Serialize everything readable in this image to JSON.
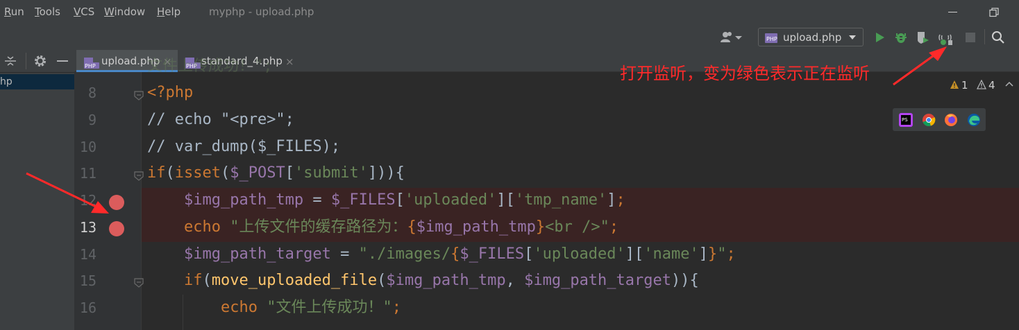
{
  "menu": {
    "items": [
      "Run",
      "Tools",
      "VCS",
      "Window",
      "Help"
    ],
    "window_title": "myphp - upload.php"
  },
  "toolbar": {
    "run_config": "upload.php",
    "icons": [
      "user-icon",
      "run-icon",
      "debug-icon",
      "coverage-icon",
      "listen-debug-icon",
      "stop-icon",
      "search-icon"
    ]
  },
  "project": {
    "selected_item": "hp"
  },
  "tabs": [
    {
      "label": "upload.php",
      "close": "×",
      "active": true
    },
    {
      "label": "standard_4.php",
      "close": "×",
      "active": false
    }
  ],
  "inspections": {
    "errors": "1",
    "warnings": "4"
  },
  "browsers": [
    "phpstorm-icon",
    "chrome-icon",
    "firefox-icon",
    "edge-icon"
  ],
  "annotation": "打开监听，变为绿色表示正在监听",
  "breakpoints": [
    12,
    13
  ],
  "colors": {
    "keyword": "#cc7832",
    "string": "#6a8759",
    "variable": "#9876aa",
    "function": "#ffc66d",
    "comment": "#a9b7c6",
    "breakpoint": "#db5c5c",
    "annotation": "#ff2a2a"
  },
  "code": {
    "partial_top": "文件上传成功！\";",
    "lines": [
      {
        "number": "8",
        "tokens": [
          {
            "t": "<?php",
            "c": "keyword"
          }
        ]
      },
      {
        "number": "9",
        "tokens": [
          {
            "t": "// echo \"<pre>\";",
            "c": "plain"
          }
        ]
      },
      {
        "number": "10",
        "tokens": [
          {
            "t": "// var_dump($_FILES);",
            "c": "plain"
          }
        ]
      },
      {
        "number": "11",
        "tokens": [
          {
            "t": "if",
            "c": "keyword"
          },
          {
            "t": "(",
            "c": "plain"
          },
          {
            "t": "isset",
            "c": "keyword"
          },
          {
            "t": "(",
            "c": "plain"
          },
          {
            "t": "$_POST",
            "c": "variable"
          },
          {
            "t": "[",
            "c": "plain"
          },
          {
            "t": "'submit'",
            "c": "string"
          },
          {
            "t": "])){",
            "c": "plain"
          }
        ]
      },
      {
        "number": "12",
        "tokens": [
          {
            "t": "    ",
            "c": "plain"
          },
          {
            "t": "$img_path_tmp",
            "c": "variable"
          },
          {
            "t": " = ",
            "c": "plain"
          },
          {
            "t": "$_FILES",
            "c": "variable"
          },
          {
            "t": "[",
            "c": "plain"
          },
          {
            "t": "'uploaded'",
            "c": "string"
          },
          {
            "t": "][",
            "c": "plain"
          },
          {
            "t": "'tmp_name'",
            "c": "string"
          },
          {
            "t": "]",
            "c": "plain"
          },
          {
            "t": ";",
            "c": "keyword"
          }
        ]
      },
      {
        "number": "13",
        "tokens": [
          {
            "t": "    ",
            "c": "plain"
          },
          {
            "t": "echo",
            "c": "keyword"
          },
          {
            "t": " \"上传文件的缓存路径为：",
            "c": "string"
          },
          {
            "t": "{",
            "c": "keyword"
          },
          {
            "t": "$img_path_tmp",
            "c": "variable"
          },
          {
            "t": "}",
            "c": "keyword"
          },
          {
            "t": "<br />\"",
            "c": "string"
          },
          {
            "t": ";",
            "c": "keyword"
          }
        ]
      },
      {
        "number": "14",
        "tokens": [
          {
            "t": "    ",
            "c": "plain"
          },
          {
            "t": "$img_path_target",
            "c": "variable"
          },
          {
            "t": " = ",
            "c": "plain"
          },
          {
            "t": "\"./images/",
            "c": "string"
          },
          {
            "t": "{",
            "c": "keyword"
          },
          {
            "t": "$_FILES",
            "c": "variable"
          },
          {
            "t": "[",
            "c": "plain"
          },
          {
            "t": "'uploaded'",
            "c": "string"
          },
          {
            "t": "][",
            "c": "plain"
          },
          {
            "t": "'name'",
            "c": "string"
          },
          {
            "t": "]",
            "c": "plain"
          },
          {
            "t": "}",
            "c": "keyword"
          },
          {
            "t": "\"",
            "c": "string"
          },
          {
            "t": ";",
            "c": "keyword"
          }
        ]
      },
      {
        "number": "15",
        "tokens": [
          {
            "t": "    ",
            "c": "plain"
          },
          {
            "t": "if",
            "c": "keyword"
          },
          {
            "t": "(",
            "c": "plain"
          },
          {
            "t": "move_uploaded_file",
            "c": "function"
          },
          {
            "t": "(",
            "c": "plain"
          },
          {
            "t": "$img_path_tmp",
            "c": "variable"
          },
          {
            "t": ", ",
            "c": "plain"
          },
          {
            "t": "$img_path_target",
            "c": "variable"
          },
          {
            "t": ")){",
            "c": "plain"
          }
        ]
      },
      {
        "number": "16",
        "tokens": [
          {
            "t": "        ",
            "c": "plain"
          },
          {
            "t": "echo",
            "c": "keyword"
          },
          {
            "t": " \"文件上传成功！\"",
            "c": "string"
          },
          {
            "t": ";",
            "c": "keyword"
          }
        ]
      }
    ]
  }
}
